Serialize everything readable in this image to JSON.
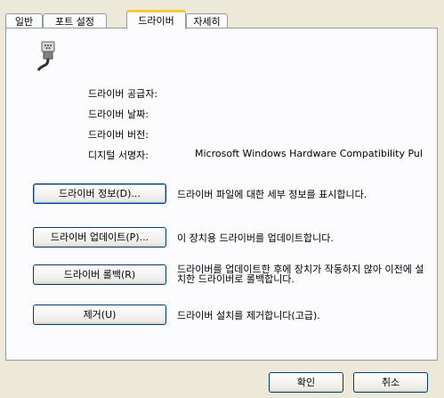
{
  "tabs": [
    {
      "label": "일반"
    },
    {
      "label": "포트 설정"
    },
    {
      "label": "드라이버"
    },
    {
      "label": "자세히"
    }
  ],
  "icon": "serial-port-icon",
  "info": {
    "provider_label": "드라이버 공급자:",
    "date_label": "드라이버 날짜:",
    "version_label": "드라이버 버전:",
    "signer_label": "디지털 서명자:",
    "signer_value": "Microsoft Windows Hardware Compatibility Pul"
  },
  "actions": {
    "details_button": "드라이버 정보(D)...",
    "details_desc": "드라이버 파일에 대한 세부 정보를 표시합니다.",
    "update_button": "드라이버 업데이트(P)...",
    "update_desc": "이 장치용 드라이버를 업데이트합니다.",
    "rollback_button": "드라이버 롤백(R)",
    "rollback_desc": "드라이버를 업데이트한 후에 장치가 작동하지 않아 이전에 설치한 드라이버로 롤백합니다.",
    "uninstall_button": "제거(U)",
    "uninstall_desc": "드라이버 설치를 제거합니다(고급)."
  },
  "footer": {
    "ok": "확인",
    "cancel": "취소"
  }
}
